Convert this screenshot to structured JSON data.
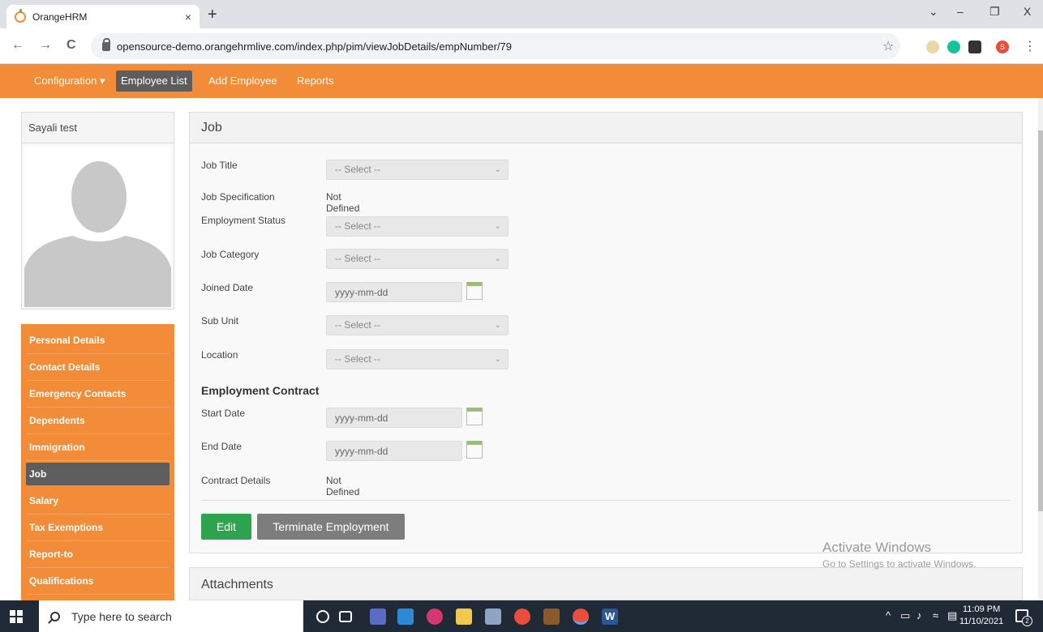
{
  "browser": {
    "tab_title": "OrangeHRM",
    "tab_close": "×",
    "new_tab": "+",
    "url": "opensource-demo.orangehrmlive.com/index.php/pim/viewJobDetails/empNumber/79",
    "window_minimize": "–",
    "window_restore": "❐",
    "window_close": "X",
    "tab_search": "⌄",
    "back": "←",
    "forward": "→",
    "reload": "C",
    "star": "☆",
    "profile_initial": "S",
    "menu": "⋮"
  },
  "topnav": {
    "items": [
      {
        "label": "Configuration ▾"
      },
      {
        "label": "Employee List"
      },
      {
        "label": "Add Employee"
      },
      {
        "label": "Reports"
      }
    ]
  },
  "profile": {
    "name": "Sayali test"
  },
  "sidemenu": {
    "items": [
      {
        "label": "Personal Details"
      },
      {
        "label": "Contact Details"
      },
      {
        "label": "Emergency Contacts"
      },
      {
        "label": "Dependents"
      },
      {
        "label": "Immigration"
      },
      {
        "label": "Job"
      },
      {
        "label": "Salary"
      },
      {
        "label": "Tax Exemptions"
      },
      {
        "label": "Report-to"
      },
      {
        "label": "Qualifications"
      }
    ],
    "active_index": 5
  },
  "job_panel": {
    "title": "Job",
    "job_title_label": "Job Title",
    "job_title_value": "-- Select --",
    "job_spec_label": "Job Specification",
    "job_spec_value": "Not Defined",
    "emp_status_label": "Employment Status",
    "emp_status_value": "-- Select --",
    "job_category_label": "Job Category",
    "job_category_value": "-- Select --",
    "joined_date_label": "Joined Date",
    "joined_date_placeholder": "yyyy-mm-dd",
    "sub_unit_label": "Sub Unit",
    "sub_unit_value": "-- Select --",
    "location_label": "Location",
    "location_value": "-- Select --",
    "contract_heading": "Employment Contract",
    "start_date_label": "Start Date",
    "start_date_placeholder": "yyyy-mm-dd",
    "end_date_label": "End Date",
    "end_date_placeholder": "yyyy-mm-dd",
    "contract_details_label": "Contract Details",
    "contract_details_value": "Not Defined",
    "edit_button": "Edit",
    "terminate_button": "Terminate Employment"
  },
  "attachments_panel": {
    "title": "Attachments"
  },
  "watermark": {
    "line1": "Activate Windows",
    "line2": "Go to Settings to activate Windows."
  },
  "taskbar": {
    "search_placeholder": "Type here to search",
    "time": "11:09 PM",
    "date": "11/10/2021",
    "notification_count": "2"
  },
  "colors": {
    "brand_orange": "#f28c38",
    "active_dark": "#5d5d5d",
    "edit_green": "#2ea44f",
    "terminate_gray": "#7d7d7d"
  }
}
